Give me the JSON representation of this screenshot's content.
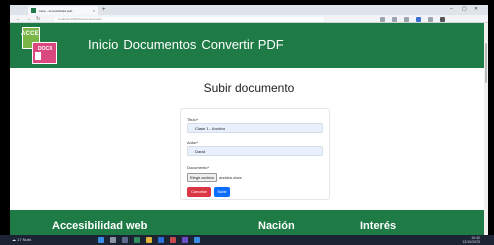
{
  "browser": {
    "tab_title": "Inicio - Accesibilidad web",
    "tab_close": "×",
    "new_tab": "+",
    "url": "localhost:3000/documentos/subir",
    "window_controls": [
      "–",
      "▢",
      "✕"
    ]
  },
  "header": {
    "logo_top": "ACCE",
    "logo_bottom": "DOCX",
    "nav": [
      "Inicio",
      "Documentos",
      "Convertir PDF"
    ]
  },
  "main": {
    "title": "Subir documento",
    "form": {
      "title_label": "Titulo*",
      "title_value": "Clase 1 - Archivo",
      "author_label": "Autor*",
      "author_value": "David",
      "document_label": "Documento*",
      "file_button": "Elegir archivo",
      "file_name": "archivo.docx",
      "cancel": "Cancelar",
      "submit": "Subir"
    }
  },
  "footer": {
    "headings": [
      "Accesibilidad web",
      "Nación",
      "Interés"
    ]
  },
  "taskbar": {
    "weather": "☁ 17 Nubl.",
    "time": "10:42",
    "date": "12/10/2023"
  },
  "colors": {
    "brand_green": "#1e7b46",
    "cancel_red": "#dc3545",
    "submit_blue": "#0d6efd",
    "field_bg": "#e8f0fe"
  }
}
